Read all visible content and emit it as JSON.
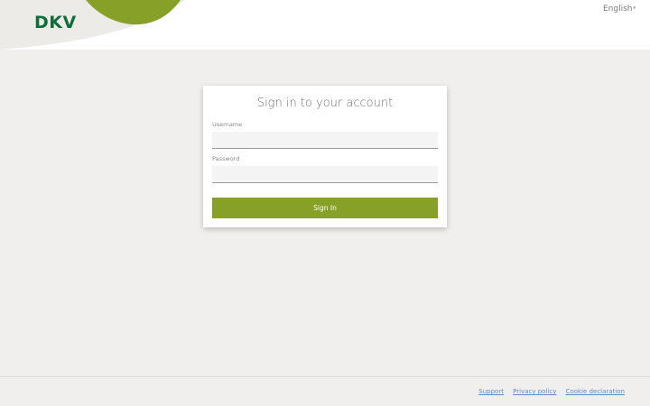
{
  "header": {
    "logo_text": "DKV",
    "language": "English",
    "language_caret": "▾"
  },
  "colors": {
    "brand_green": "#0f6e3a",
    "accent_green": "#87a128",
    "link_blue": "#5a8dc8",
    "page_bg": "#f0efed"
  },
  "login": {
    "title": "Sign in to your account",
    "username_label": "Username",
    "username_value": "",
    "password_label": "Password",
    "password_value": "",
    "submit_label": "Sign In"
  },
  "footer": {
    "links": [
      "Support",
      "Privacy policy",
      "Cookie declaration"
    ]
  }
}
